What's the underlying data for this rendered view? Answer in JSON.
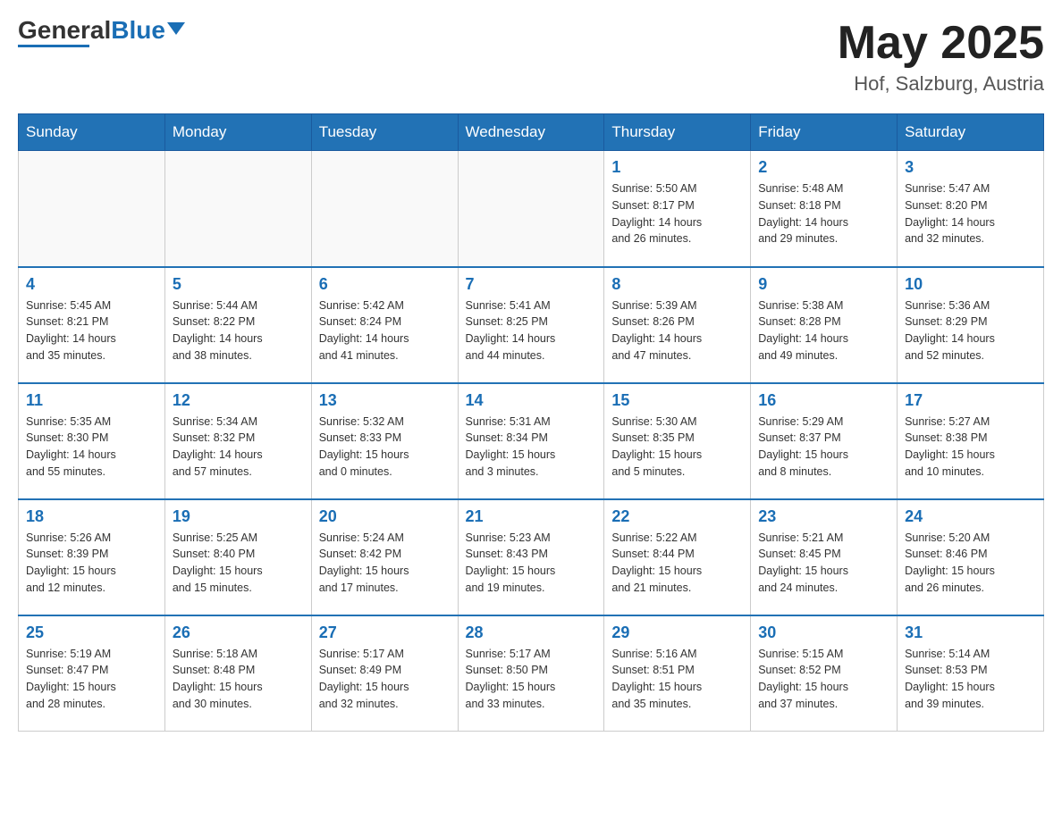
{
  "header": {
    "logo_text_black": "General",
    "logo_text_blue": "Blue",
    "month_year": "May 2025",
    "location": "Hof, Salzburg, Austria"
  },
  "weekdays": [
    "Sunday",
    "Monday",
    "Tuesday",
    "Wednesday",
    "Thursday",
    "Friday",
    "Saturday"
  ],
  "weeks": [
    [
      {
        "day": "",
        "info": ""
      },
      {
        "day": "",
        "info": ""
      },
      {
        "day": "",
        "info": ""
      },
      {
        "day": "",
        "info": ""
      },
      {
        "day": "1",
        "info": "Sunrise: 5:50 AM\nSunset: 8:17 PM\nDaylight: 14 hours\nand 26 minutes."
      },
      {
        "day": "2",
        "info": "Sunrise: 5:48 AM\nSunset: 8:18 PM\nDaylight: 14 hours\nand 29 minutes."
      },
      {
        "day": "3",
        "info": "Sunrise: 5:47 AM\nSunset: 8:20 PM\nDaylight: 14 hours\nand 32 minutes."
      }
    ],
    [
      {
        "day": "4",
        "info": "Sunrise: 5:45 AM\nSunset: 8:21 PM\nDaylight: 14 hours\nand 35 minutes."
      },
      {
        "day": "5",
        "info": "Sunrise: 5:44 AM\nSunset: 8:22 PM\nDaylight: 14 hours\nand 38 minutes."
      },
      {
        "day": "6",
        "info": "Sunrise: 5:42 AM\nSunset: 8:24 PM\nDaylight: 14 hours\nand 41 minutes."
      },
      {
        "day": "7",
        "info": "Sunrise: 5:41 AM\nSunset: 8:25 PM\nDaylight: 14 hours\nand 44 minutes."
      },
      {
        "day": "8",
        "info": "Sunrise: 5:39 AM\nSunset: 8:26 PM\nDaylight: 14 hours\nand 47 minutes."
      },
      {
        "day": "9",
        "info": "Sunrise: 5:38 AM\nSunset: 8:28 PM\nDaylight: 14 hours\nand 49 minutes."
      },
      {
        "day": "10",
        "info": "Sunrise: 5:36 AM\nSunset: 8:29 PM\nDaylight: 14 hours\nand 52 minutes."
      }
    ],
    [
      {
        "day": "11",
        "info": "Sunrise: 5:35 AM\nSunset: 8:30 PM\nDaylight: 14 hours\nand 55 minutes."
      },
      {
        "day": "12",
        "info": "Sunrise: 5:34 AM\nSunset: 8:32 PM\nDaylight: 14 hours\nand 57 minutes."
      },
      {
        "day": "13",
        "info": "Sunrise: 5:32 AM\nSunset: 8:33 PM\nDaylight: 15 hours\nand 0 minutes."
      },
      {
        "day": "14",
        "info": "Sunrise: 5:31 AM\nSunset: 8:34 PM\nDaylight: 15 hours\nand 3 minutes."
      },
      {
        "day": "15",
        "info": "Sunrise: 5:30 AM\nSunset: 8:35 PM\nDaylight: 15 hours\nand 5 minutes."
      },
      {
        "day": "16",
        "info": "Sunrise: 5:29 AM\nSunset: 8:37 PM\nDaylight: 15 hours\nand 8 minutes."
      },
      {
        "day": "17",
        "info": "Sunrise: 5:27 AM\nSunset: 8:38 PM\nDaylight: 15 hours\nand 10 minutes."
      }
    ],
    [
      {
        "day": "18",
        "info": "Sunrise: 5:26 AM\nSunset: 8:39 PM\nDaylight: 15 hours\nand 12 minutes."
      },
      {
        "day": "19",
        "info": "Sunrise: 5:25 AM\nSunset: 8:40 PM\nDaylight: 15 hours\nand 15 minutes."
      },
      {
        "day": "20",
        "info": "Sunrise: 5:24 AM\nSunset: 8:42 PM\nDaylight: 15 hours\nand 17 minutes."
      },
      {
        "day": "21",
        "info": "Sunrise: 5:23 AM\nSunset: 8:43 PM\nDaylight: 15 hours\nand 19 minutes."
      },
      {
        "day": "22",
        "info": "Sunrise: 5:22 AM\nSunset: 8:44 PM\nDaylight: 15 hours\nand 21 minutes."
      },
      {
        "day": "23",
        "info": "Sunrise: 5:21 AM\nSunset: 8:45 PM\nDaylight: 15 hours\nand 24 minutes."
      },
      {
        "day": "24",
        "info": "Sunrise: 5:20 AM\nSunset: 8:46 PM\nDaylight: 15 hours\nand 26 minutes."
      }
    ],
    [
      {
        "day": "25",
        "info": "Sunrise: 5:19 AM\nSunset: 8:47 PM\nDaylight: 15 hours\nand 28 minutes."
      },
      {
        "day": "26",
        "info": "Sunrise: 5:18 AM\nSunset: 8:48 PM\nDaylight: 15 hours\nand 30 minutes."
      },
      {
        "day": "27",
        "info": "Sunrise: 5:17 AM\nSunset: 8:49 PM\nDaylight: 15 hours\nand 32 minutes."
      },
      {
        "day": "28",
        "info": "Sunrise: 5:17 AM\nSunset: 8:50 PM\nDaylight: 15 hours\nand 33 minutes."
      },
      {
        "day": "29",
        "info": "Sunrise: 5:16 AM\nSunset: 8:51 PM\nDaylight: 15 hours\nand 35 minutes."
      },
      {
        "day": "30",
        "info": "Sunrise: 5:15 AM\nSunset: 8:52 PM\nDaylight: 15 hours\nand 37 minutes."
      },
      {
        "day": "31",
        "info": "Sunrise: 5:14 AM\nSunset: 8:53 PM\nDaylight: 15 hours\nand 39 minutes."
      }
    ]
  ]
}
